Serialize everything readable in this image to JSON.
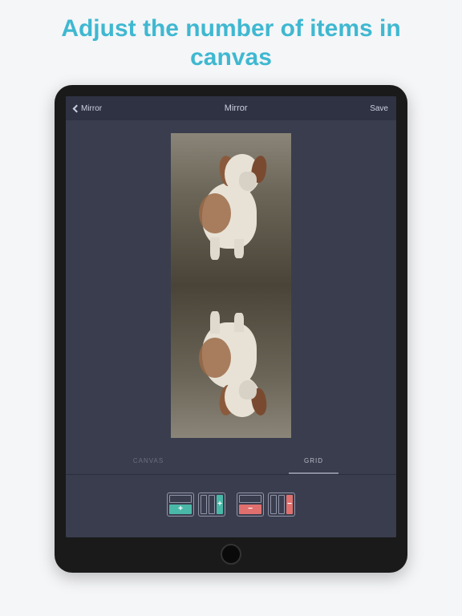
{
  "promo": {
    "title": "Adjust the number of items in canvas"
  },
  "navbar": {
    "back_label": "Mirror",
    "title": "Mirror",
    "save_label": "Save"
  },
  "tabs": {
    "canvas": "CANVAS",
    "grid": "GRID",
    "active": "grid"
  },
  "controls": {
    "add_row_symbol": "+",
    "add_col_symbol": "+",
    "remove_row_symbol": "−",
    "remove_col_symbol": "−"
  },
  "colors": {
    "accent_add": "#4ab8a8",
    "accent_remove": "#e0706e",
    "brand": "#3fb8d1",
    "screen_bg": "#3a3d4d"
  }
}
